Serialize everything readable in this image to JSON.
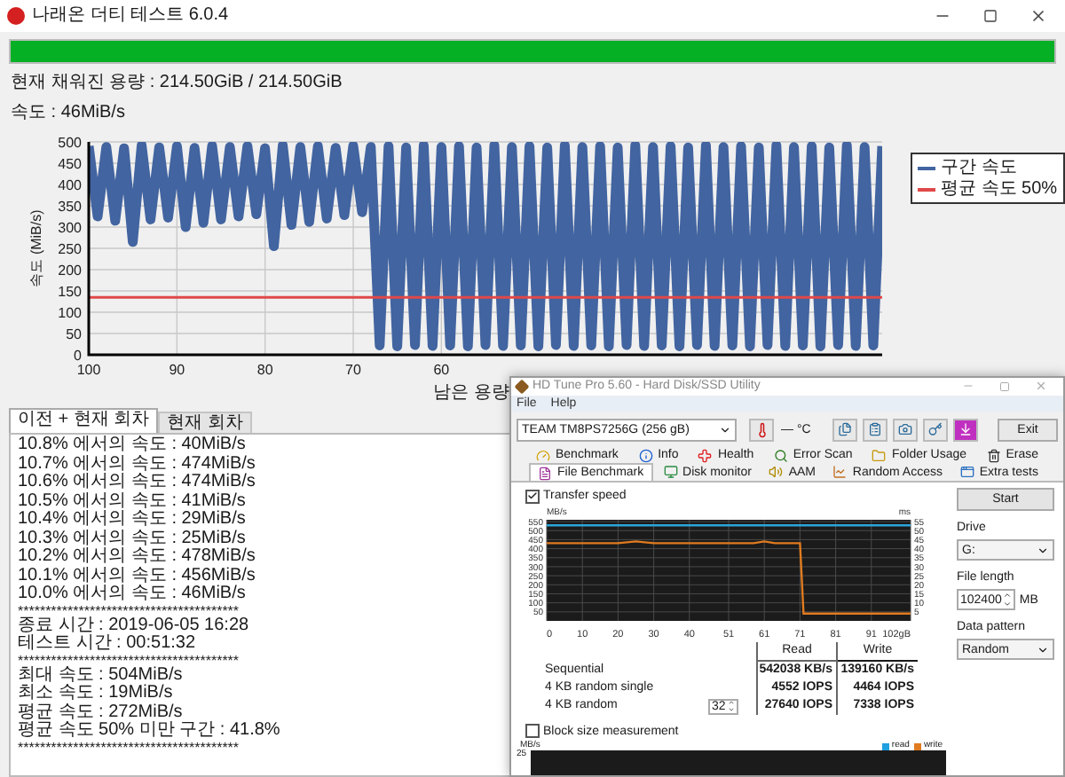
{
  "main_window": {
    "title": "나래온 더티 테스트 6.0.4",
    "progress": {
      "level": 1
    },
    "filled_capacity": "현재 채워진 용량 : 214.50GiB / 214.50GiB",
    "speed": "속도 : 46MiB/s",
    "chart": {
      "chart_data": {
        "type": "line",
        "grid": true,
        "xlabel": "남은 용량",
        "ylabel": "속도 (MiB/s)",
        "xlim": [
          100,
          10
        ],
        "ylim": [
          0,
          500
        ],
        "xticks": [
          100,
          90,
          80,
          70,
          60
        ],
        "yticks": [
          0,
          50,
          100,
          150,
          200,
          250,
          300,
          350,
          400,
          450,
          500
        ],
        "x": [
          100,
          99,
          98,
          97,
          96,
          95,
          94,
          93,
          92,
          91,
          90,
          89,
          88,
          87,
          86,
          85,
          84,
          83,
          82,
          81,
          80,
          79,
          78,
          77,
          76,
          75,
          74,
          73,
          72,
          71,
          70,
          69,
          68,
          67,
          66,
          65,
          64,
          63,
          62,
          61,
          60,
          59,
          58,
          57,
          56,
          55,
          54,
          53,
          52,
          51,
          50,
          49,
          48,
          47,
          46,
          45,
          44,
          43,
          42,
          41,
          40,
          39,
          38,
          37,
          36,
          35,
          34,
          33,
          32,
          31,
          30,
          29,
          28,
          27,
          26,
          25,
          24,
          23,
          22,
          21,
          20,
          19,
          18,
          17,
          16,
          15,
          14,
          13,
          12,
          11,
          10
        ],
        "series": [
          {
            "name": "구간 속도",
            "color": "#4264a0",
            "values": [
              490,
              325,
              488,
              315,
              485,
              265,
              492,
              318,
              487,
              322,
              490,
              300,
              486,
              310,
              491,
              318,
              488,
              325,
              490,
              330,
              485,
              255,
              492,
              305,
              488,
              312,
              490,
              320,
              486,
              328,
              491,
              335,
              488,
              22,
              490,
              20,
              487,
              23,
              492,
              21,
              488,
              22,
              490,
              20,
              487,
              23,
              492,
              21,
              488,
              22,
              490,
              20,
              487,
              23,
              492,
              21,
              488,
              22,
              490,
              20,
              487,
              23,
              492,
              21,
              488,
              22,
              490,
              20,
              487,
              23,
              492,
              21,
              488,
              22,
              490,
              20,
              487,
              23,
              492,
              21,
              488,
              22,
              490,
              20,
              487,
              23,
              492,
              21,
              488,
              22,
              490
            ]
          },
          {
            "name": "평균 속도 50%",
            "color": "#e04848",
            "values": [
              135,
              135,
              135,
              135,
              135,
              135,
              135,
              135,
              135,
              135,
              135,
              135,
              135,
              135,
              135,
              135,
              135,
              135,
              135,
              135,
              135,
              135,
              135,
              135,
              135,
              135,
              135,
              135,
              135,
              135,
              135,
              135,
              135,
              135,
              135,
              135,
              135,
              135,
              135,
              135,
              135,
              135,
              135,
              135,
              135,
              135,
              135,
              135,
              135,
              135,
              135,
              135,
              135,
              135,
              135,
              135,
              135,
              135,
              135,
              135,
              135,
              135,
              135,
              135,
              135,
              135,
              135,
              135,
              135,
              135,
              135,
              135,
              135,
              135,
              135,
              135,
              135,
              135,
              135,
              135,
              135,
              135,
              135,
              135,
              135,
              135,
              135,
              135,
              135,
              135,
              135
            ]
          }
        ]
      }
    },
    "log_tabs": [
      {
        "label": "이전 + 현재 회차",
        "selected": true
      },
      {
        "label": "현재 회차",
        "selected": false
      }
    ],
    "log_lines": [
      {
        "kind": "text",
        "text": "10.8% 에서의 속도 : 40MiB/s"
      },
      {
        "kind": "text",
        "text": "10.7% 에서의 속도 : 474MiB/s"
      },
      {
        "kind": "text",
        "text": "10.6% 에서의 속도 : 474MiB/s"
      },
      {
        "kind": "text",
        "text": "10.5% 에서의 속도 : 41MiB/s"
      },
      {
        "kind": "text",
        "text": "10.4% 에서의 속도 : 29MiB/s"
      },
      {
        "kind": "text",
        "text": "10.3% 에서의 속도 : 25MiB/s"
      },
      {
        "kind": "text",
        "text": "10.2% 에서의 속도 : 478MiB/s"
      },
      {
        "kind": "text",
        "text": "10.1% 에서의 속도 : 456MiB/s"
      },
      {
        "kind": "text",
        "text": "10.0% 에서의 속도 : 46MiB/s"
      },
      {
        "kind": "separator",
        "text": "****************************************"
      },
      {
        "kind": "text",
        "text": "종료 시간 : 2019-06-05 16:28"
      },
      {
        "kind": "text",
        "text": "테스트 시간 : 00:51:32"
      },
      {
        "kind": "separator",
        "text": "****************************************"
      },
      {
        "kind": "text",
        "text": "최대 속도 : 504MiB/s"
      },
      {
        "kind": "text",
        "text": "최소 속도 : 19MiB/s"
      },
      {
        "kind": "text",
        "text": "평균 속도 : 272MiB/s"
      },
      {
        "kind": "text",
        "text": "평균 속도 50% 미만 구간 : 41.8%"
      },
      {
        "kind": "separator",
        "text": "****************************************"
      }
    ]
  },
  "hdtune_window": {
    "title": "HD Tune Pro 5.60 - Hard Disk/SSD Utility",
    "menu": [
      "File",
      "Help"
    ],
    "drive_select": "TEAM TM8PS7256G (256 gB)",
    "temperature": "— °C",
    "exit_button": "Exit",
    "tabs_row_1": [
      {
        "label": "Benchmark",
        "selected": false
      },
      {
        "label": "Info",
        "selected": false
      },
      {
        "label": "Health",
        "selected": false
      },
      {
        "label": "Error Scan",
        "selected": false
      },
      {
        "label": "Folder Usage",
        "selected": false
      },
      {
        "label": "Erase",
        "selected": false
      }
    ],
    "tabs_row_2": [
      {
        "label": "File Benchmark",
        "selected": true
      },
      {
        "label": "Disk monitor",
        "selected": false
      },
      {
        "label": "AAM",
        "selected": false
      },
      {
        "label": "Random Access",
        "selected": false
      },
      {
        "label": "Extra tests",
        "selected": false
      }
    ],
    "transfer_speed": {
      "label": "Transfer speed",
      "checked": true
    },
    "chart": {
      "chart_data": {
        "type": "line",
        "grid": true,
        "ylabel": "MB/s",
        "y2label": "ms",
        "xlim": [
          0,
          102
        ],
        "ylim": [
          0,
          560
        ],
        "y2lim": [
          0,
          56
        ],
        "x": [
          0,
          10,
          20,
          25,
          30,
          40,
          51,
          58,
          61,
          64,
          71,
          72,
          81,
          91,
          102
        ],
        "xticks": [
          0,
          10,
          20,
          30,
          40,
          51,
          61,
          71,
          81,
          91,
          {
            "value": 102,
            "label": "102gB"
          }
        ],
        "yticks": [
          50,
          100,
          150,
          200,
          250,
          300,
          350,
          400,
          450,
          500,
          550
        ],
        "y2ticks": [
          5,
          10,
          15,
          20,
          25,
          30,
          35,
          40,
          45,
          50,
          55
        ],
        "series": [
          {
            "color": "#2aa6d8",
            "values": [
              530,
              530,
              530,
              530,
              530,
              530,
              530,
              530,
              530,
              530,
              530,
              530,
              530,
              530,
              530
            ]
          },
          {
            "color": "#e07b20",
            "values": [
              430,
              430,
              430,
              440,
              430,
              430,
              430,
              430,
              440,
              430,
              430,
              40,
              40,
              40,
              40
            ]
          }
        ]
      }
    },
    "results": {
      "columns": [
        "Read",
        "Write"
      ],
      "rows": [
        {
          "label": "Sequential",
          "read": "542038 KB/s",
          "write": "139160 KB/s"
        },
        {
          "label": "4 KB random single",
          "read": "4552 IOPS",
          "write": "4464 IOPS"
        },
        {
          "label": "4 KB random",
          "queue_depth": "32",
          "read": "27640 IOPS",
          "write": "7338 IOPS"
        }
      ]
    },
    "start_button": "Start",
    "drive": {
      "label": "Drive",
      "value": "G:"
    },
    "file_length": {
      "label": "File length",
      "value": "102400",
      "unit": "MB"
    },
    "data_pattern": {
      "label": "Data pattern",
      "value": "Random"
    },
    "block_size": {
      "label": "Block size measurement",
      "checked": false
    },
    "block_chart": {
      "ylabel": "MB/s",
      "ytick": "25",
      "legend": [
        {
          "label": "read",
          "color": "#1fa0e0"
        },
        {
          "label": "write",
          "color": "#e07b20"
        }
      ]
    }
  }
}
